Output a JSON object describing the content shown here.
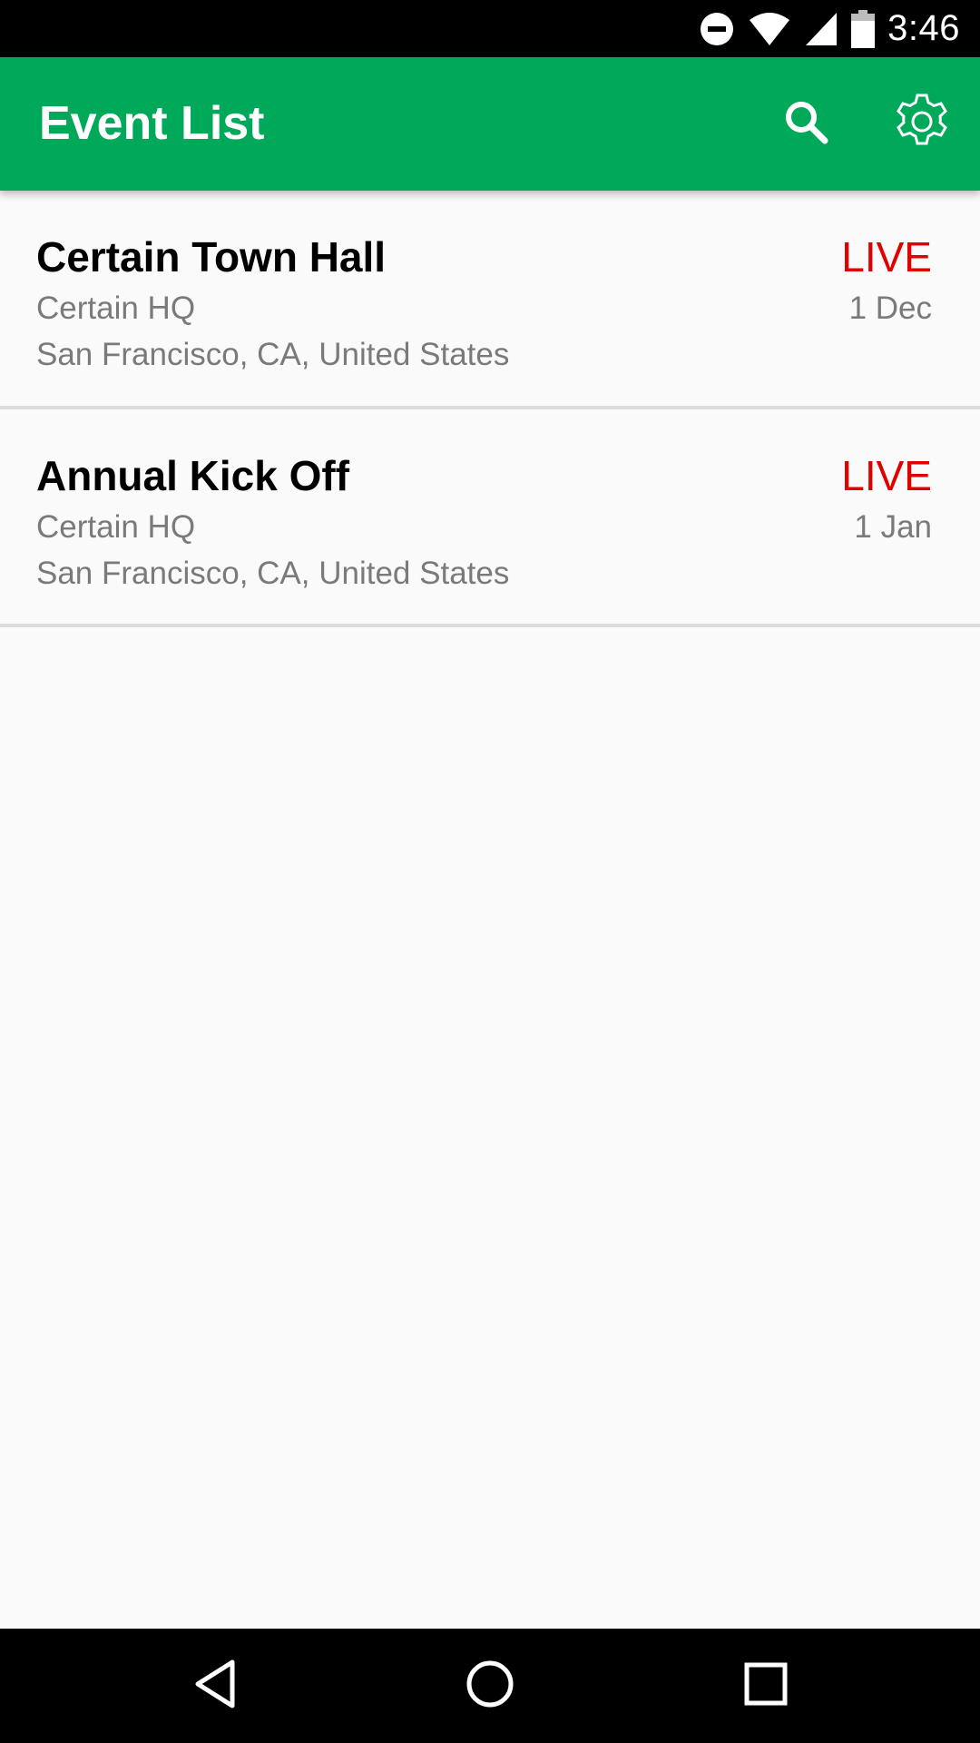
{
  "status_bar": {
    "time": "3:46",
    "icons": [
      "do-not-disturb-icon",
      "wifi-icon",
      "signal-icon",
      "battery-icon"
    ]
  },
  "app_bar": {
    "title": "Event List",
    "actions": [
      "search-icon",
      "gear-icon"
    ],
    "background_color": "#00a85a"
  },
  "events": [
    {
      "title": "Certain Town Hall",
      "venue": "Certain HQ",
      "address": "San Francisco, CA, United States",
      "status": "LIVE",
      "date": "1 Dec"
    },
    {
      "title": "Annual Kick Off",
      "venue": "Certain HQ",
      "address": "San Francisco, CA, United States",
      "status": "LIVE",
      "date": "1 Jan"
    }
  ],
  "colors": {
    "live": "#e00000",
    "secondary_text": "#7a7a7a"
  },
  "nav_bar": {
    "buttons": [
      "back-icon",
      "home-icon",
      "recents-icon"
    ]
  }
}
